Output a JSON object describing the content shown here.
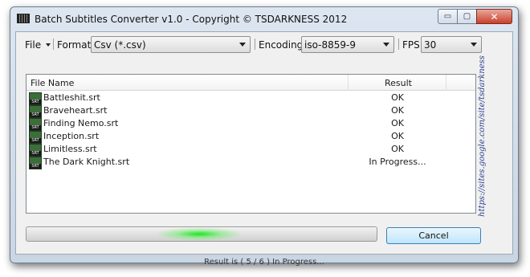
{
  "window": {
    "title": "Batch Subtitles Converter v1.0 - Copyright © TSDARKNESS 2012",
    "min_glyph": "▭",
    "max_glyph": "▢",
    "close_glyph": "✕"
  },
  "toolbar": {
    "file_label": "File",
    "format_label": "Format",
    "format_value": "Csv (*.csv)",
    "encoding_label": "Encoding",
    "encoding_value": "iso-8859-9",
    "fps_label": "FPS",
    "fps_value": "30"
  },
  "list": {
    "col_name": "File Name",
    "col_result": "Result",
    "rows": [
      {
        "name": "Battleshit.srt",
        "result": "OK"
      },
      {
        "name": "Braveheart.srt",
        "result": "OK"
      },
      {
        "name": "Finding Nemo.srt",
        "result": "OK"
      },
      {
        "name": "Inception.srt",
        "result": "OK"
      },
      {
        "name": "Limitless.srt",
        "result": "OK"
      },
      {
        "name": "The Dark Knight.srt",
        "result": "In Progress..."
      }
    ],
    "icon_badge": "SRT"
  },
  "side_link": "https://sites.google.com/site/tsdarkness",
  "cancel_label": "Cancel",
  "status_text": "Result is ( 5 / 6 ) In Progress...",
  "colors": {
    "progress_glow": "#22e022",
    "link": "#2a3f8f"
  }
}
